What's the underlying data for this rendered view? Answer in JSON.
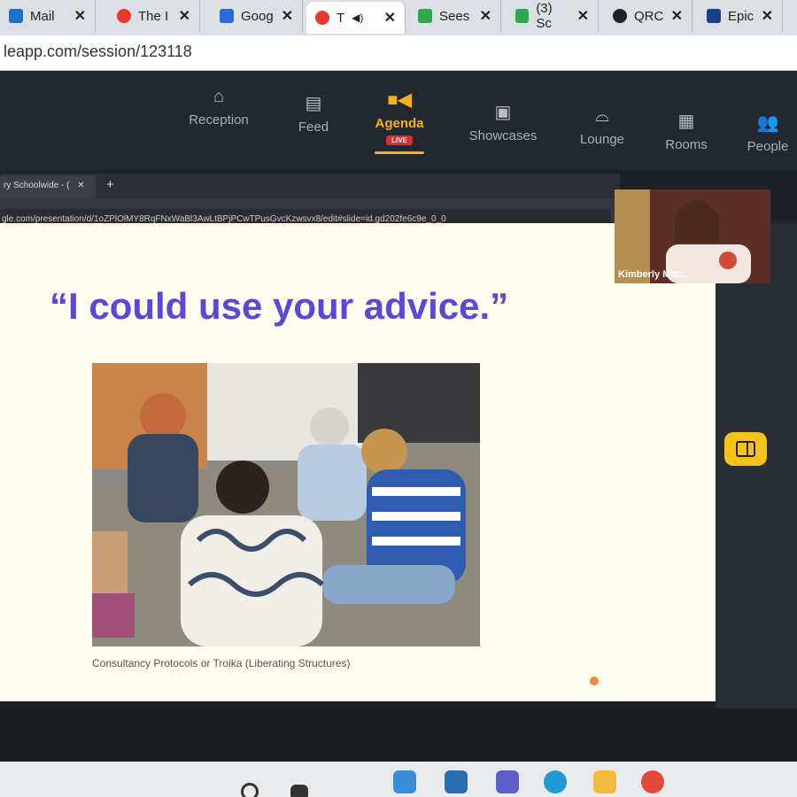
{
  "browser": {
    "tabs": [
      {
        "label": "Mail",
        "icon": "outlook-icon"
      },
      {
        "label": "The I",
        "icon": "red-dot-icon"
      },
      {
        "label": "Goog",
        "icon": "calendar-icon"
      },
      {
        "label": "T",
        "icon": "red-dot-icon",
        "active": true
      },
      {
        "label": "Sees",
        "icon": "green-bow-icon"
      },
      {
        "label": "(3) Sc",
        "icon": "green-bow-icon"
      },
      {
        "label": "QRC",
        "icon": "qr-icon"
      },
      {
        "label": "Epic",
        "icon": "epic-icon"
      }
    ],
    "url": "leapp.com/session/123118"
  },
  "app_nav": {
    "items": [
      {
        "label": "Reception",
        "icon": "home-icon"
      },
      {
        "label": "Feed",
        "icon": "feed-icon"
      },
      {
        "label": "Agenda",
        "icon": "video-icon",
        "badge": "LIVE",
        "active": true
      },
      {
        "label": "Showcases",
        "icon": "store-icon"
      },
      {
        "label": "Lounge",
        "icon": "sofa-icon"
      },
      {
        "label": "Rooms",
        "icon": "rooms-icon"
      },
      {
        "label": "People",
        "icon": "people-icon"
      }
    ]
  },
  "shared_screen": {
    "tab_label": "ry Schoolwide - (",
    "url": "gle.com/presentation/d/1oZPlOlMY8RqFNxWaBl3AwLtBPjPCwTPusGvcKzwsvx8/edit#slide=id.gd202fe6c9e_0_0"
  },
  "slide": {
    "title": "“I could use your advice.”",
    "caption": "Consultancy Protocols or Troika (Liberating Structures)"
  },
  "video": {
    "participant_name": "Kimberly Mitc..."
  },
  "colors": {
    "accent": "#f4b21a",
    "title_purple": "#5a48d6",
    "live_red": "#e02b2b"
  }
}
